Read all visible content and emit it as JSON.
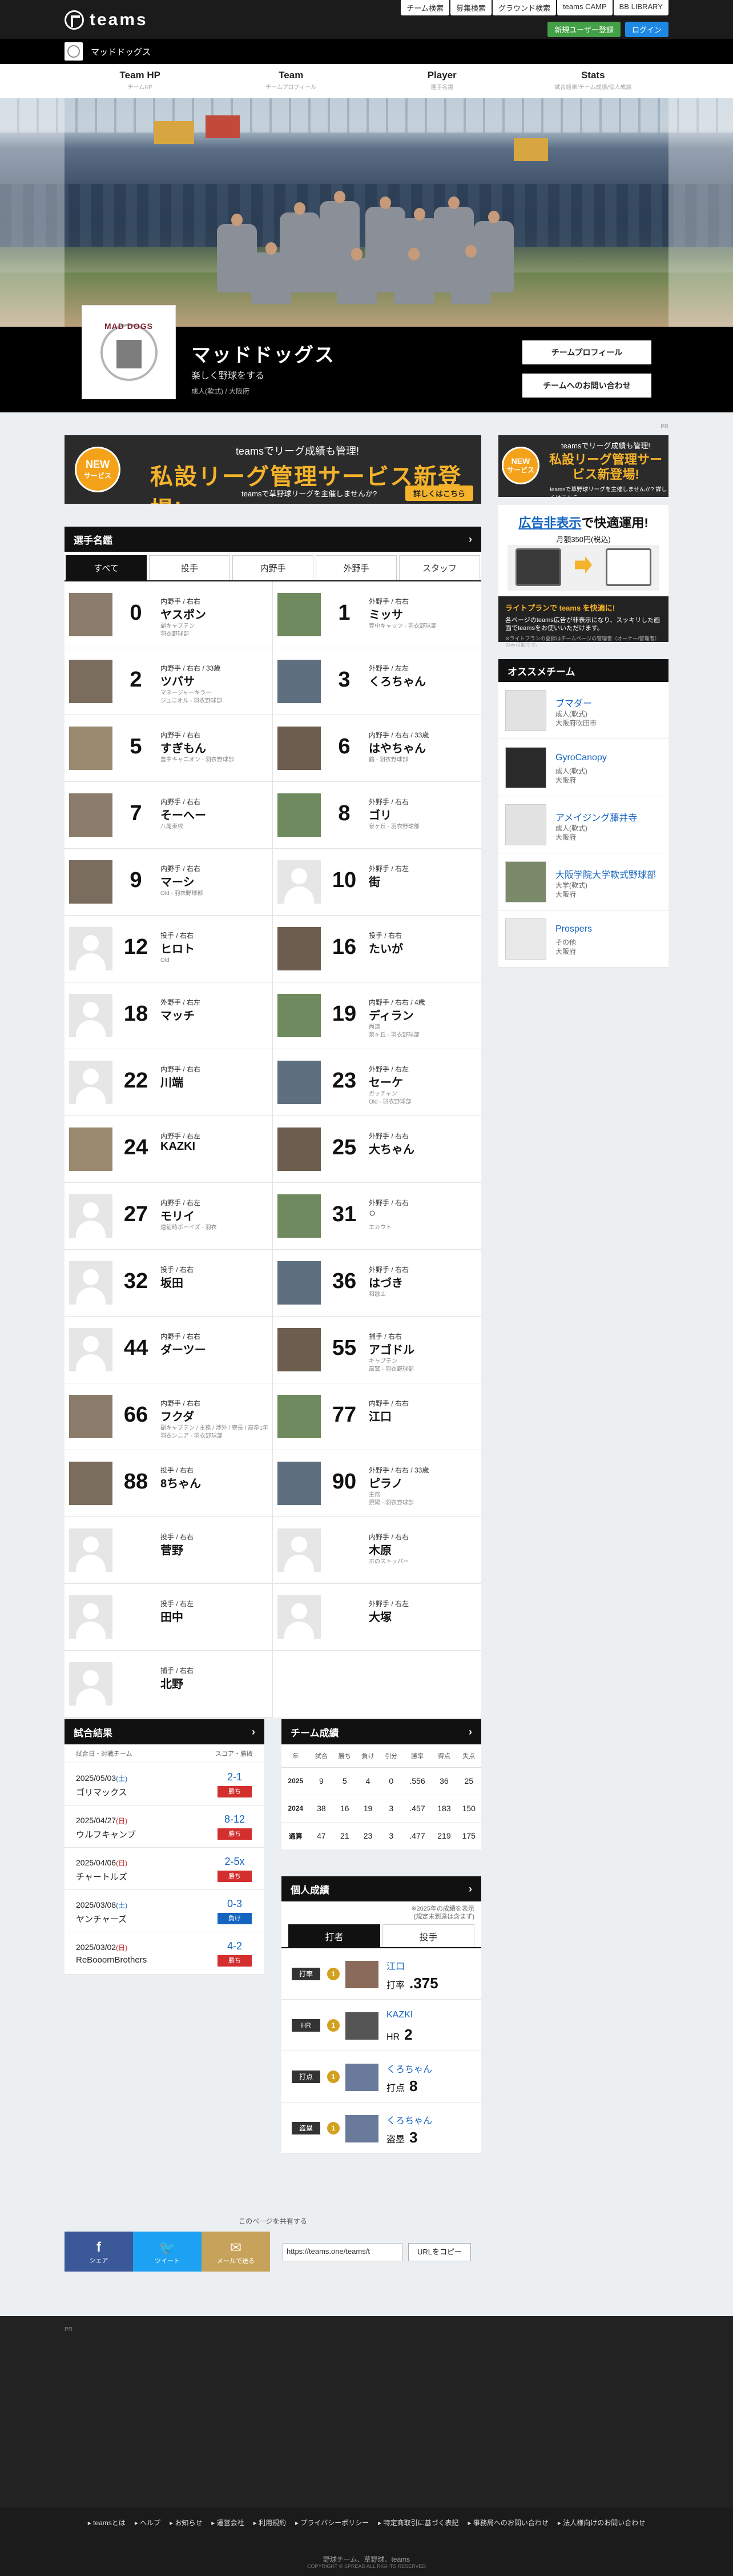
{
  "header": {
    "logo": "teams",
    "links": [
      "チーム検索",
      "募集検索",
      "グラウンド検索",
      "teams CAMP",
      "BB LIBRARY"
    ],
    "register": "新規ユーザー登録",
    "login": "ログイン"
  },
  "team_strip": {
    "name": "マッドドッグス"
  },
  "nav": [
    {
      "label": "Team HP",
      "sub": "チームHP"
    },
    {
      "label": "Team",
      "sub": "チームプロフィール"
    },
    {
      "label": "Player",
      "sub": "選手名鑑"
    },
    {
      "label": "Stats",
      "sub": "試合結果/チーム成績/個人成績"
    }
  ],
  "team": {
    "emblem_text": "MAD DOGS",
    "name": "マッドドッグス",
    "catch": "楽しく野球をする",
    "area": "成人(軟式) / 大阪府",
    "btn_profile": "チームプロフィール",
    "btn_contact": "チームへのお問い合わせ"
  },
  "pr": "PR",
  "banner": {
    "new1": "NEW",
    "new2": "サービス",
    "t1": "teamsでリーグ成績も管理!",
    "t2": "私設リーグ管理サービス新登場!",
    "t3": "teamsで草野球リーグを主催しませんか?",
    "t4": "詳しくはこちら"
  },
  "roster": {
    "title": "選手名鑑",
    "tabs": [
      "すべて",
      "投手",
      "内野手",
      "外野手",
      "スタッフ"
    ],
    "players": [
      {
        "no": "0",
        "pos": "内野手 / 右右",
        "name": "ヤスポン",
        "note": "副キャプテン\n羽衣野球部",
        "photo": true
      },
      {
        "no": "1",
        "pos": "外野手 / 右右",
        "name": "ミッサ",
        "note": "豊中キャッツ - 羽衣野球部",
        "photo": true
      },
      {
        "no": "2",
        "pos": "内野手 / 右右 / 33歳",
        "name": "ツバサ",
        "note": "マネージャーキラー\nジュニオル - 羽衣野球部",
        "photo": true
      },
      {
        "no": "3",
        "pos": "外野手 / 左左",
        "name": "くろちゃん",
        "note": "",
        "photo": true
      },
      {
        "no": "5",
        "pos": "内野手 / 右右",
        "name": "すぎもん",
        "note": "豊中キャニオン - 羽衣野球部",
        "photo": true
      },
      {
        "no": "6",
        "pos": "内野手 / 右右 / 33歳",
        "name": "はやちゃん",
        "note": "鶴 - 羽衣野球部",
        "photo": true
      },
      {
        "no": "7",
        "pos": "内野手 / 右右",
        "name": "そーへー",
        "note": "八尾東校",
        "photo": true
      },
      {
        "no": "8",
        "pos": "外野手 / 右右",
        "name": "ゴリ",
        "note": "泉ヶ丘 - 羽衣野球部",
        "photo": true
      },
      {
        "no": "9",
        "pos": "内野手 / 右右",
        "name": "マーシ",
        "note": "Old - 羽衣野球部",
        "photo": true
      },
      {
        "no": "10",
        "pos": "外野手 / 右左",
        "name": "街",
        "note": "",
        "photo": false
      },
      {
        "no": "12",
        "pos": "投手 / 右右",
        "name": "ヒロト",
        "note": "Old",
        "photo": false
      },
      {
        "no": "16",
        "pos": "投手 / 右右",
        "name": "たいが",
        "note": "",
        "photo": true
      },
      {
        "no": "18",
        "pos": "外野手 / 右左",
        "name": "マッチ",
        "note": "",
        "photo": false
      },
      {
        "no": "19",
        "pos": "内野手 / 右右 / 4歳",
        "name": "ディラン",
        "note": "尚道\n泉ヶ丘 - 羽衣野球部",
        "photo": true
      },
      {
        "no": "22",
        "pos": "内野手 / 右右",
        "name": "川端",
        "note": "",
        "photo": false
      },
      {
        "no": "23",
        "pos": "外野手 / 右左",
        "name": "セーケ",
        "note": "ガッチャン\nOld - 羽衣野球部",
        "photo": true
      },
      {
        "no": "24",
        "pos": "内野手 / 右左",
        "name": "KAZKI",
        "note": "",
        "photo": true
      },
      {
        "no": "25",
        "pos": "外野手 / 右右",
        "name": "大ちゃん",
        "note": "",
        "photo": true
      },
      {
        "no": "27",
        "pos": "内野手 / 右左",
        "name": "モリイ",
        "note": "遠征時ボーイズ - 羽衣",
        "photo": false
      },
      {
        "no": "31",
        "pos": "外野手 / 右右",
        "name": "○",
        "note": "エカウト",
        "photo": true
      },
      {
        "no": "32",
        "pos": "投手 / 右右",
        "name": "坂田",
        "note": "",
        "photo": false
      },
      {
        "no": "36",
        "pos": "外野手 / 右右",
        "name": "はづき",
        "note": "和歌山",
        "photo": true
      },
      {
        "no": "44",
        "pos": "内野手 / 右右",
        "name": "ダーツー",
        "note": "",
        "photo": false
      },
      {
        "no": "55",
        "pos": "捕手 / 右右",
        "name": "アゴドル",
        "note": "キャプテン\n高鷲 - 羽衣野球部",
        "photo": true
      },
      {
        "no": "66",
        "pos": "内野手 / 右右",
        "name": "フクダ",
        "note": "副キャプテン / 主務 / 渉外 / 寮長 / 高卒1年\n羽衣シニア - 羽衣野球部",
        "photo": true
      },
      {
        "no": "77",
        "pos": "内野手 / 右右",
        "name": "江口",
        "note": "",
        "photo": true
      },
      {
        "no": "88",
        "pos": "投手 / 右右",
        "name": "8ちゃん",
        "note": "",
        "photo": true
      },
      {
        "no": "90",
        "pos": "外野手 / 右右 / 33歳",
        "name": "ピラノ",
        "note": "主務\n摂陽 - 羽衣野球部",
        "photo": true
      },
      {
        "no": "",
        "pos": "投手 / 右右",
        "name": "菅野",
        "note": "",
        "photo": false
      },
      {
        "no": "",
        "pos": "内野手 / 右右",
        "name": "木原",
        "note": "ホのストッパー",
        "photo": false
      },
      {
        "no": "",
        "pos": "投手 / 右左",
        "name": "田中",
        "note": "",
        "photo": false
      },
      {
        "no": "",
        "pos": "外野手 / 右左",
        "name": "大塚",
        "note": "",
        "photo": false
      },
      {
        "no": "",
        "pos": "捕手 / 右右",
        "name": "北野",
        "note": "",
        "photo": false
      }
    ]
  },
  "results": {
    "title": "試合結果",
    "head_l": "試合日・対戦チーム",
    "head_r": "スコア・勝敗",
    "rows": [
      {
        "date": "2025/05/03",
        "wd": "(土)",
        "opp": "ゴリマックス",
        "score": "2-1",
        "res": "勝ち",
        "win": true
      },
      {
        "date": "2025/04/27",
        "wd": "(日)",
        "opp": "ウルフキャンプ",
        "score": "8-12",
        "res": "勝ち",
        "win": true
      },
      {
        "date": "2025/04/06",
        "wd": "(日)",
        "opp": "チャートルズ",
        "score": "2-5x",
        "res": "勝ち",
        "win": true
      },
      {
        "date": "2025/03/08",
        "wd": "(土)",
        "opp": "ヤンチャーズ",
        "score": "0-3",
        "res": "負け",
        "win": false
      },
      {
        "date": "2025/03/02",
        "wd": "(日)",
        "opp": "ReBooornBrothers",
        "score": "4-2",
        "res": "勝ち",
        "win": true
      }
    ]
  },
  "team_stats": {
    "title": "チーム成績",
    "cols": [
      "年",
      "試合",
      "勝ち",
      "負け",
      "引分",
      "勝率",
      "得点",
      "失点"
    ],
    "rows": [
      [
        "2025",
        "9",
        "5",
        "4",
        "0",
        ".556",
        "36",
        "25"
      ],
      [
        "2024",
        "38",
        "16",
        "19",
        "3",
        ".457",
        "183",
        "150"
      ],
      [
        "通算",
        "47",
        "21",
        "23",
        "3",
        ".477",
        "219",
        "175"
      ]
    ]
  },
  "indiv": {
    "title": "個人成績",
    "note1": "※2025年の成績を表示",
    "note2": "(規定未到達は含まず)",
    "tabs": [
      "打者",
      "投手"
    ],
    "rows": [
      {
        "cat": "打率",
        "rank": "1",
        "name": "江口",
        "label": "打率",
        "val": ".375"
      },
      {
        "cat": "HR",
        "rank": "1",
        "name": "KAZKI",
        "label": "HR",
        "val": "2"
      },
      {
        "cat": "打点",
        "rank": "1",
        "name": "くろちゃん",
        "label": "打点",
        "val": "8"
      },
      {
        "cat": "盗塁",
        "rank": "1",
        "name": "くろちゃん",
        "label": "盗塁",
        "val": "3"
      }
    ]
  },
  "side_ad": {
    "new1": "NEW",
    "new2": "サービス",
    "a1": "teamsでリーグ成績も管理!",
    "a2": "私設リーグ管理サービス新登場!",
    "a3": "teamsで草野球リーグを主催しませんか? 詳しくはこちら"
  },
  "adfree": {
    "h1a": "広告非表示",
    "h1b": "で快適運用!",
    "h2": "月額350円(税込)",
    "b1": "ライトプランで teams を快適に!",
    "b2": "各ページのteams広告が非表示になり、スッキリした画面でteamsをお使いいただけます。",
    "b3": "※ライトプランの登録はチームページの管理者（オーナー/管理者）のみ可能です。"
  },
  "rec": {
    "title": "オススメチーム",
    "items": [
      {
        "name": "ブマダー",
        "cat": "成人(軟式)",
        "area": "大阪府吹田市"
      },
      {
        "name": "GyroCanopy",
        "cat": "成人(軟式)",
        "area": "大阪府"
      },
      {
        "name": "アメイジング藤井寺",
        "cat": "成人(軟式)",
        "area": "大阪府"
      },
      {
        "name": "大阪学院大学軟式野球部",
        "cat": "大学(軟式)",
        "area": "大阪府"
      },
      {
        "name": "Prospers",
        "cat": "その他",
        "area": "大阪府"
      }
    ]
  },
  "share": {
    "label": "このページを共有する",
    "f": "シェア",
    "t": "ツイート",
    "m": "メールで送る",
    "url": "https://teams.one/teams/t",
    "copy": "URLをコピー"
  },
  "footer": {
    "links": [
      "teamsとは",
      "ヘルプ",
      "お知らせ",
      "運営会社",
      "利用規約",
      "プライバシーポリシー",
      "特定商取引に基づく表記",
      "事務局へのお問い合わせ",
      "法人様向けのお問い合わせ"
    ],
    "copy1": "野球チーム、草野球、teams",
    "copy2": "COPYRIGHT © SPREAD ALL RIGHTS RESERVED"
  },
  "colors": {
    "accent_blue": "#1565c0",
    "win": "#d32f2f",
    "lose": "#1565c0",
    "ad_gold": "#f5b32b"
  }
}
